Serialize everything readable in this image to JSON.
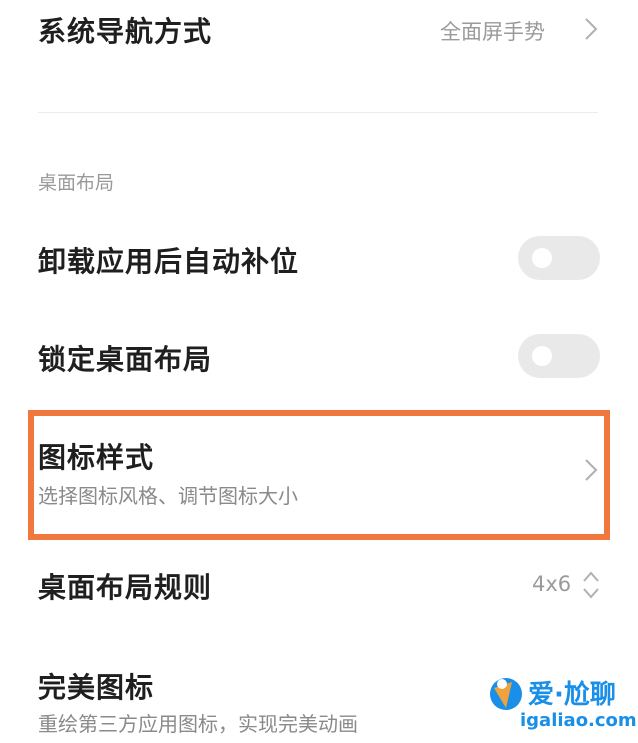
{
  "nav_mode": {
    "title": "系统导航方式",
    "value": "全面屏手势"
  },
  "section": {
    "header": "桌面布局"
  },
  "auto_fill": {
    "title": "卸载应用后自动补位",
    "enabled": false
  },
  "lock_layout": {
    "title": "锁定桌面布局",
    "enabled": false
  },
  "icon_style": {
    "title": "图标样式",
    "subtitle": "选择图标风格、调节图标大小"
  },
  "layout_rule": {
    "title": "桌面布局规则",
    "value": "4x6"
  },
  "perfect_icon": {
    "title": "完美图标",
    "subtitle": "重绘第三方应用图标，实现完美动画"
  },
  "watermark": {
    "text": "爱·尬聊",
    "domain": "igaliao.com"
  },
  "colors": {
    "highlight": "#f0783c",
    "toggle_off": "#e9e9e9",
    "watermark": "#1a8fe8"
  }
}
